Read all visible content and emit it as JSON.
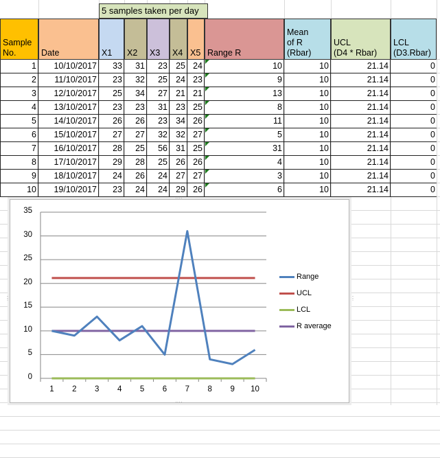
{
  "sheet": {
    "banner": "5 samples taken per day",
    "headers": {
      "sample": [
        "Sample",
        "No."
      ],
      "date": "Date",
      "x1": "X1",
      "x2": "X2",
      "x3": "X3",
      "x4": "X4",
      "x5": "X5",
      "range": "Range R",
      "mean": [
        "Mean",
        "of R",
        "(Rbar)"
      ],
      "ucl": [
        "UCL",
        "(D4 * Rbar)"
      ],
      "lcl": [
        "LCL",
        "(D3.Rbar)"
      ]
    },
    "rows": [
      {
        "no": "1",
        "date": "10/10/2017",
        "x1": "33",
        "x2": "31",
        "x3": "23",
        "x4": "25",
        "x5": "24",
        "range": "10",
        "rbar": "10",
        "ucl": "21.14",
        "lcl": "0"
      },
      {
        "no": "2",
        "date": "11/10/2017",
        "x1": "23",
        "x2": "32",
        "x3": "25",
        "x4": "24",
        "x5": "23",
        "range": "9",
        "rbar": "10",
        "ucl": "21.14",
        "lcl": "0"
      },
      {
        "no": "3",
        "date": "12/10/2017",
        "x1": "25",
        "x2": "34",
        "x3": "27",
        "x4": "21",
        "x5": "21",
        "range": "13",
        "rbar": "10",
        "ucl": "21.14",
        "lcl": "0"
      },
      {
        "no": "4",
        "date": "13/10/2017",
        "x1": "23",
        "x2": "23",
        "x3": "31",
        "x4": "23",
        "x5": "25",
        "range": "8",
        "rbar": "10",
        "ucl": "21.14",
        "lcl": "0"
      },
      {
        "no": "5",
        "date": "14/10/2017",
        "x1": "26",
        "x2": "26",
        "x3": "23",
        "x4": "34",
        "x5": "26",
        "range": "11",
        "rbar": "10",
        "ucl": "21.14",
        "lcl": "0"
      },
      {
        "no": "6",
        "date": "15/10/2017",
        "x1": "27",
        "x2": "27",
        "x3": "32",
        "x4": "32",
        "x5": "27",
        "range": "5",
        "rbar": "10",
        "ucl": "21.14",
        "lcl": "0"
      },
      {
        "no": "7",
        "date": "16/10/2017",
        "x1": "28",
        "x2": "25",
        "x3": "56",
        "x4": "31",
        "x5": "25",
        "range": "31",
        "rbar": "10",
        "ucl": "21.14",
        "lcl": "0"
      },
      {
        "no": "8",
        "date": "17/10/2017",
        "x1": "29",
        "x2": "28",
        "x3": "25",
        "x4": "26",
        "x5": "26",
        "range": "4",
        "rbar": "10",
        "ucl": "21.14",
        "lcl": "0"
      },
      {
        "no": "9",
        "date": "18/10/2017",
        "x1": "24",
        "x2": "26",
        "x3": "24",
        "x4": "27",
        "x5": "27",
        "range": "3",
        "rbar": "10",
        "ucl": "21.14",
        "lcl": "0"
      },
      {
        "no": "10",
        "date": "19/10/2017",
        "x1": "23",
        "x2": "24",
        "x3": "24",
        "x4": "29",
        "x5": "26",
        "range": "6",
        "rbar": "10",
        "ucl": "21.14",
        "lcl": "0"
      }
    ],
    "colors": {
      "sample": "#ffc000",
      "date": "#fac090",
      "x1": "#c5d9f1",
      "x2": "#c4bd97",
      "x3": "#ccc0da",
      "x4": "#c4bd97",
      "x5": "#fac090",
      "range": "#da9694",
      "mean": "#b7dee8",
      "ucl": "#d7e4bc",
      "lcl": "#b7dee8",
      "banner": "#d7e4bc"
    }
  },
  "chart_data": {
    "type": "line",
    "categories": [
      "1",
      "2",
      "3",
      "4",
      "5",
      "6",
      "7",
      "8",
      "9",
      "10"
    ],
    "series": [
      {
        "name": "Range",
        "color": "#4f81bd",
        "values": [
          10,
          9,
          13,
          8,
          11,
          5,
          31,
          4,
          3,
          6
        ]
      },
      {
        "name": "UCL",
        "color": "#c0504d",
        "values": [
          21.14,
          21.14,
          21.14,
          21.14,
          21.14,
          21.14,
          21.14,
          21.14,
          21.14,
          21.14
        ]
      },
      {
        "name": "LCL",
        "color": "#9bbb59",
        "values": [
          0,
          0,
          0,
          0,
          0,
          0,
          0,
          0,
          0,
          0
        ]
      },
      {
        "name": "R average",
        "color": "#8064a2",
        "values": [
          10,
          10,
          10,
          10,
          10,
          10,
          10,
          10,
          10,
          10
        ]
      }
    ],
    "yticks": [
      "0",
      "5",
      "10",
      "15",
      "20",
      "25",
      "30",
      "35"
    ],
    "ylim": [
      0,
      35
    ],
    "grid": true,
    "legend": "right"
  }
}
